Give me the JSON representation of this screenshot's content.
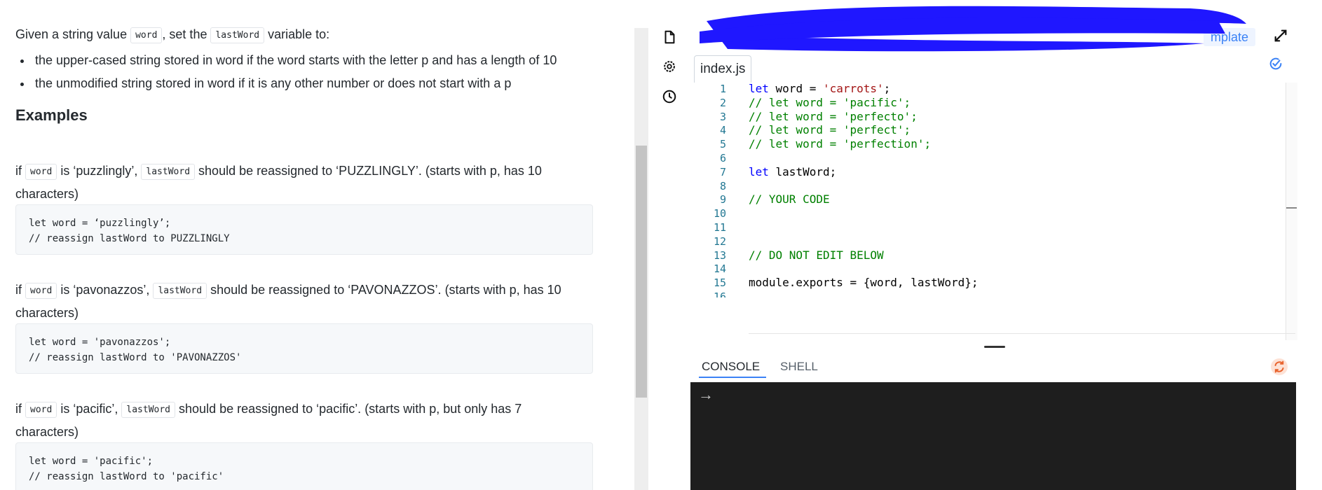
{
  "instructions": {
    "intro_prefix": "Given a string value",
    "intro_code1": "word",
    "intro_mid": ", set the",
    "intro_code2": "lastWord",
    "intro_suffix": "variable to:",
    "bullets": [
      "the upper-cased string stored in word if the word starts with the letter p and has a length of 10",
      "the unmodified string stored in word if it is any other number or does not start with a p"
    ]
  },
  "examples": {
    "heading": "Examples",
    "items": [
      {
        "pre": "if",
        "code1": "word",
        "mid": "is ‘puzzlingly’,",
        "code2": "lastWord",
        "post": "should be reassigned to ‘PUZZLINGLY’. (starts with p, has 10",
        "cont": "characters)",
        "code_lines": [
          "let word = ‘puzzlingly’;",
          "// reassign lastWord to PUZZLINGLY"
        ]
      },
      {
        "pre": "if",
        "code1": "word",
        "mid": "is ‘pavonazzos’,",
        "code2": "lastWord",
        "post": "should be reassigned to ‘PAVONAZZOS’. (starts with p, has 10",
        "cont": "characters)",
        "code_lines": [
          "let word = 'pavonazzos';",
          "// reassign lastWord to 'PAVONAZZOS'"
        ]
      },
      {
        "pre": "if",
        "code1": "word",
        "mid": "is ‘pacific’,",
        "code2": "lastWord",
        "post": "should be reassigned to ‘pacific’. (starts with p, but only has 7",
        "cont": "characters)",
        "code_lines": [
          "let word = 'pacific';",
          "// reassign lastWord to 'pacific'"
        ]
      }
    ]
  },
  "toolbar": {
    "template_label": "mplate",
    "icons": [
      "file-icon",
      "settings-icon",
      "history-icon",
      "expand-icon",
      "check-icon"
    ]
  },
  "editor": {
    "tab": "index.js",
    "line_numbers": [
      "1",
      "2",
      "3",
      "4",
      "5",
      "6",
      "7",
      "8",
      "9",
      "10",
      "11",
      "12",
      "13",
      "14",
      "15",
      "16"
    ],
    "lines": [
      "let word = 'carrots';",
      "// let word = 'pacific';",
      "// let word = 'perfecto';",
      "// let word = 'perfect';",
      "// let word = 'perfection';",
      "",
      "let lastWord;",
      "",
      "// YOUR CODE",
      "",
      "",
      "",
      "// DO NOT EDIT BELOW",
      "",
      "module.exports = {word, lastWord};",
      ""
    ]
  },
  "console": {
    "tabs": [
      "CONSOLE",
      "SHELL"
    ],
    "prompt": "→"
  },
  "colors": {
    "accent": "#3b82f6",
    "console_bg": "#1e1e1e",
    "refresh": "#e8622c"
  }
}
